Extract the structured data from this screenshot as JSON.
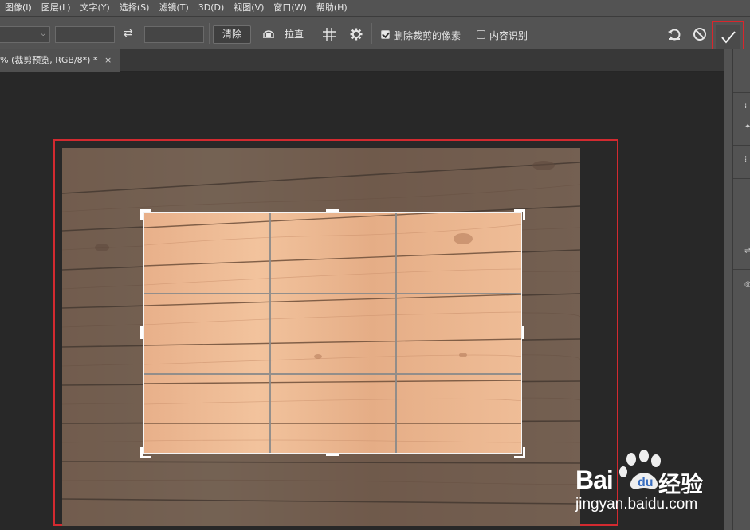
{
  "menu": [
    "图像(I)",
    "图层(L)",
    "文字(Y)",
    "选择(S)",
    "滤镜(T)",
    "3D(D)",
    "视图(V)",
    "窗口(W)",
    "帮助(H)"
  ],
  "options": {
    "clear_label": "清除",
    "straighten_label": "拉直",
    "delete_pixels_label": "删除裁剪的像素",
    "delete_pixels_checked": true,
    "content_aware_label": "内容识别",
    "content_aware_checked": false
  },
  "document_tab": {
    "title": "% (裁剪预览, RGB/8*) *",
    "close": "×"
  },
  "watermark": {
    "brand_left": "Bai",
    "brand_right": "经验",
    "url": "jingyan.baidu.com"
  },
  "colors": {
    "highlight": "#d22a30",
    "panel": "#535353",
    "canvas": "#282828"
  }
}
